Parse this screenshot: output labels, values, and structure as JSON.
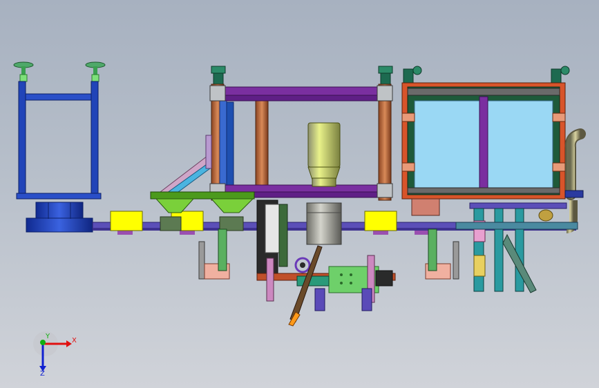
{
  "triad": {
    "x_label": "X",
    "y_label": "Y",
    "z_label": "Z"
  },
  "colors": {
    "frame_blue": "#1f3fa6",
    "purple_beam": "#7a2fa0",
    "copper_post": "#c06a3a",
    "glass": "#9ad8f4",
    "yellow_block": "#ffff00",
    "green_hopper": "#58c41c",
    "conveyor": "#5b4fb8",
    "triad_x": "#e01010",
    "triad_y": "#10b010",
    "triad_z": "#1020d0"
  }
}
